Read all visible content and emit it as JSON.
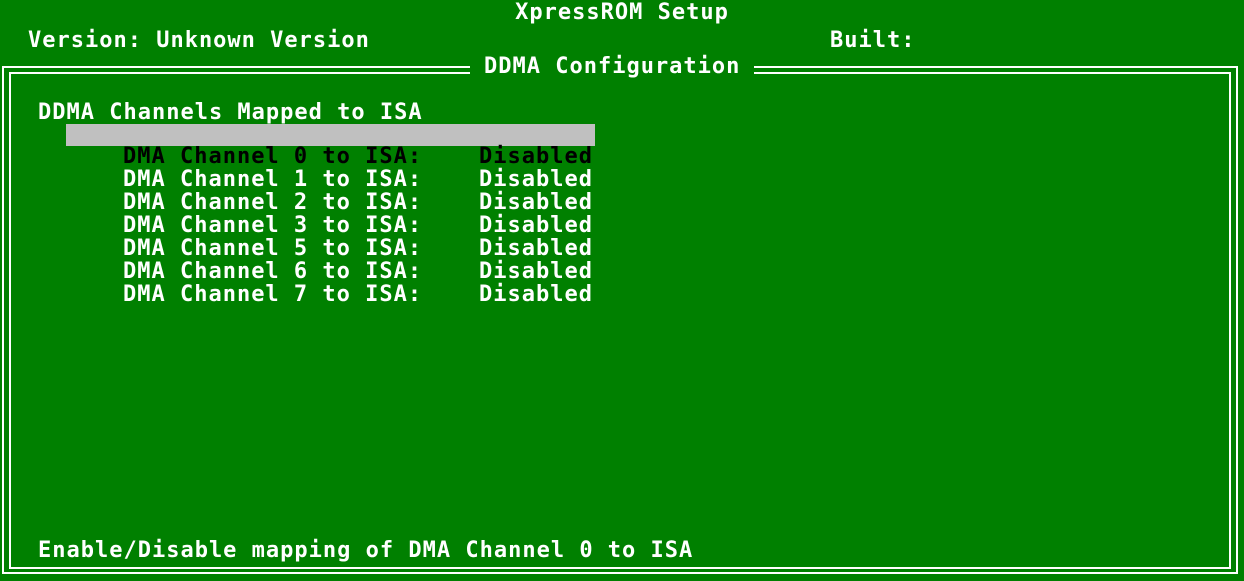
{
  "header": {
    "title": "XpressROM Setup",
    "version_line": "Version: Unknown Version",
    "built_label": "Built:"
  },
  "panel": {
    "title": "DDMA Configuration",
    "section_heading": "DDMA Channels Mapped to ISA",
    "items": [
      {
        "label": "DMA Channel 0 to ISA:",
        "value": "Disabled",
        "selected": true
      },
      {
        "label": "DMA Channel 1 to ISA:",
        "value": "Disabled",
        "selected": false
      },
      {
        "label": "DMA Channel 2 to ISA:",
        "value": "Disabled",
        "selected": false
      },
      {
        "label": "DMA Channel 3 to ISA:",
        "value": "Disabled",
        "selected": false
      },
      {
        "label": "DMA Channel 5 to ISA:",
        "value": "Disabled",
        "selected": false
      },
      {
        "label": "DMA Channel 6 to ISA:",
        "value": "Disabled",
        "selected": false
      },
      {
        "label": "DMA Channel 7 to ISA:",
        "value": "Disabled",
        "selected": false
      }
    ],
    "help_text": "Enable/Disable mapping of DMA Channel 0 to ISA"
  },
  "colors": {
    "background": "#008000",
    "foreground": "#ffffff",
    "highlight_bg": "#c0c0c0",
    "highlight_fg": "#000000"
  }
}
